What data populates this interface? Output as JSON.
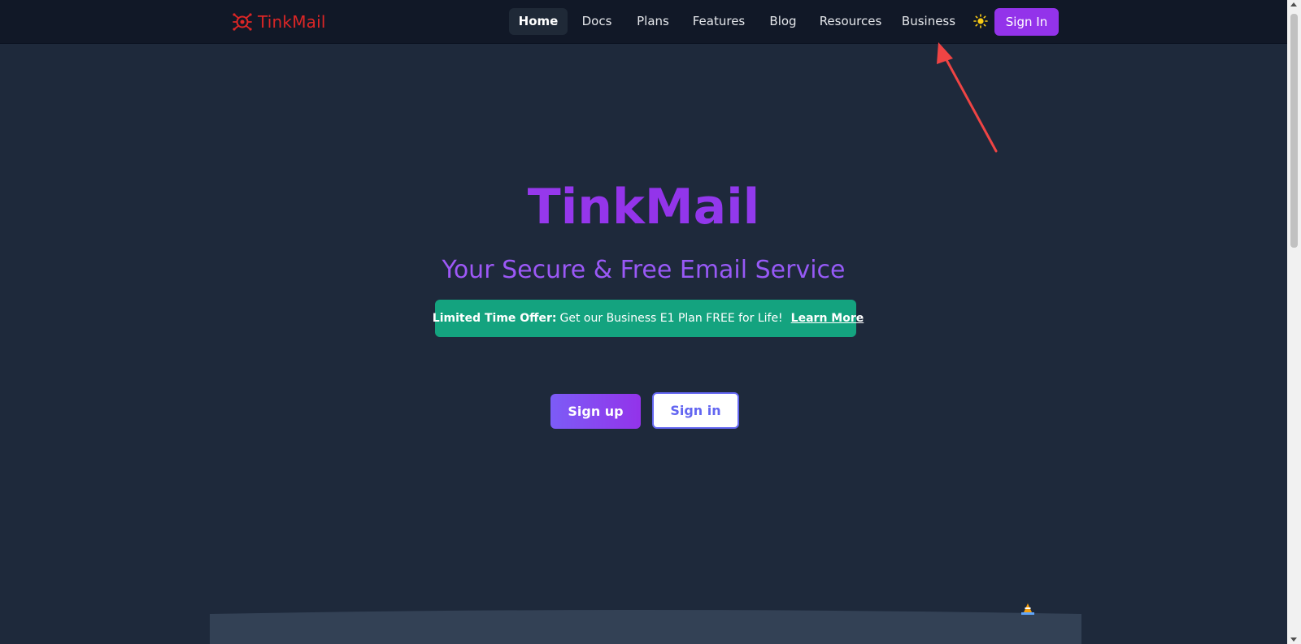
{
  "brand": {
    "name": "TinkMail",
    "color": "#dc2626"
  },
  "nav": {
    "items": [
      {
        "label": "Home",
        "active": true
      },
      {
        "label": "Docs"
      },
      {
        "label": "Plans"
      },
      {
        "label": "Features"
      },
      {
        "label": "Blog"
      },
      {
        "label": "Resources"
      },
      {
        "label": "Business"
      }
    ],
    "theme_icon": "sun-icon",
    "sign_in_label": "Sign In"
  },
  "hero": {
    "title": "TinkMail",
    "subtitle": "Your Secure & Free Email Service",
    "offer": {
      "icon": "gift-icon",
      "label": "Limited Time Offer:",
      "text": "Get our Business E1 Plan FREE for Life!",
      "link": "Learn More"
    },
    "sign_up_label": "Sign up",
    "sign_in_label": "Sign in"
  },
  "colors": {
    "background": "#1e293b",
    "navbar": "#111827",
    "accent_purple": "#9333ea",
    "offer_green": "#14a37f",
    "annotation_red": "#ef4444"
  }
}
